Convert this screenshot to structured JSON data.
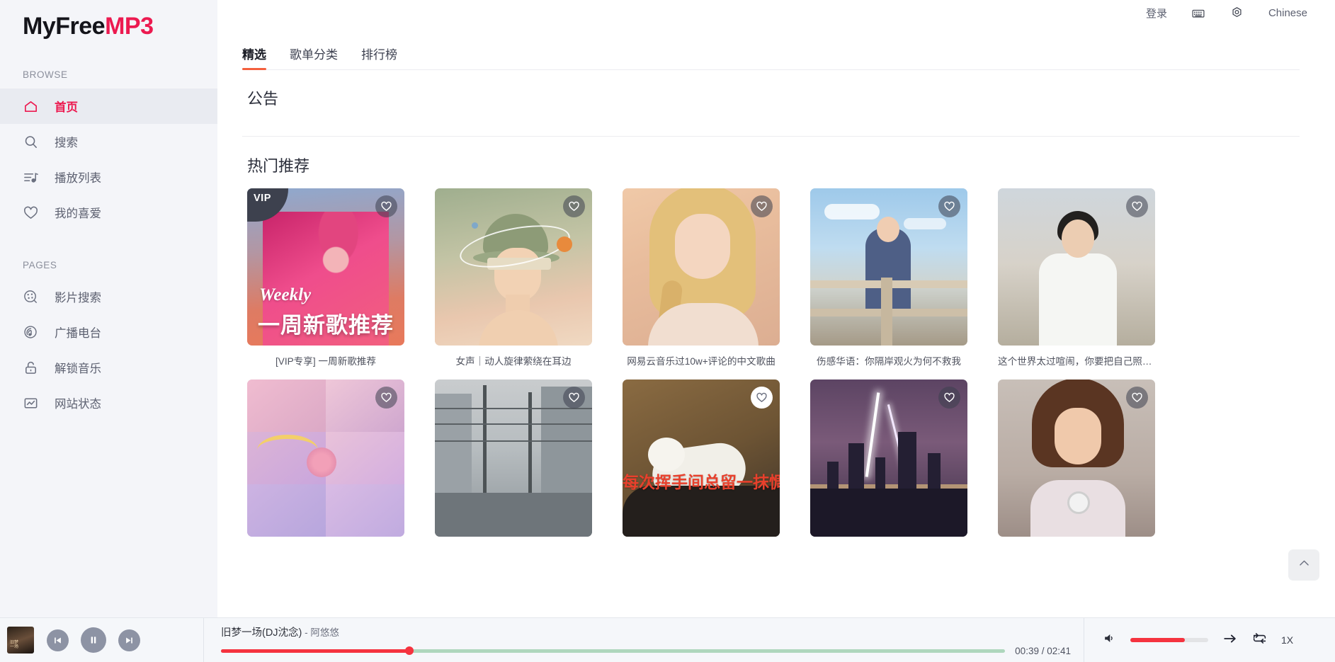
{
  "brand": {
    "part1": "MyFree",
    "part2": "MP3"
  },
  "sidebar": {
    "groups": [
      {
        "label": "BROWSE",
        "items": [
          {
            "label": "首页",
            "icon": "home-icon",
            "active": true
          },
          {
            "label": "搜索",
            "icon": "search-icon",
            "active": false
          },
          {
            "label": "播放列表",
            "icon": "playlist-icon",
            "active": false
          },
          {
            "label": "我的喜爱",
            "icon": "heart-icon",
            "active": false
          }
        ]
      },
      {
        "label": "PAGES",
        "items": [
          {
            "label": "影片搜索",
            "icon": "film-search-icon",
            "active": false
          },
          {
            "label": "广播电台",
            "icon": "radio-icon",
            "active": false
          },
          {
            "label": "解锁音乐",
            "icon": "unlock-icon",
            "active": false
          },
          {
            "label": "网站状态",
            "icon": "status-chart-icon",
            "active": false
          }
        ]
      }
    ]
  },
  "topbar": {
    "login": "登录",
    "keyboard_icon": "keyboard-icon",
    "settings_icon": "gear-icon",
    "language": "Chinese"
  },
  "tabs": [
    {
      "label": "精选",
      "active": true
    },
    {
      "label": "歌单分类",
      "active": false
    },
    {
      "label": "排行榜",
      "active": false
    }
  ],
  "sections": {
    "announcement_title": "公告",
    "recommend_title": "热门推荐"
  },
  "cards_row1": [
    {
      "caption": "[VIP专享] 一周新歌推荐",
      "badge": "VIP",
      "art": "art-weekly",
      "weekly_en": "Weekly",
      "weekly_zh": "一周新歌推荐"
    },
    {
      "caption": "女声｜动人旋律萦绕在耳边",
      "badge": "",
      "art": "art-fem"
    },
    {
      "caption": "网易云音乐过10w+评论的中文歌曲",
      "badge": "",
      "art": "art-lisa"
    },
    {
      "caption": "伤感华语：你隔岸观火为何不救我",
      "badge": "",
      "art": "art-rail"
    },
    {
      "caption": "这个世界太过喧闹，你要把自己照顾好",
      "badge": "",
      "art": "art-shirt"
    }
  ],
  "cards_row2": [
    {
      "caption": "",
      "badge": "",
      "art": "art-collage",
      "overlay": ""
    },
    {
      "caption": "",
      "badge": "",
      "art": "art-street",
      "overlay": ""
    },
    {
      "caption": "",
      "badge": "",
      "art": "art-cat",
      "overlay": "每次挥手间总留一抹惆怅"
    },
    {
      "caption": "",
      "badge": "",
      "art": "art-light",
      "overlay": ""
    },
    {
      "caption": "",
      "badge": "",
      "art": "art-girl",
      "overlay": ""
    }
  ],
  "scroll_top_icon": "chevron-up-icon",
  "player": {
    "prev_icon": "previous-track-icon",
    "play_pause_icon": "pause-icon",
    "next_icon": "next-track-icon",
    "track_title": "旧梦一场(DJ沈念)",
    "track_separator": " - ",
    "track_artist": "阿悠悠",
    "time": "00:39 / 02:41",
    "progress_percent": 24,
    "volume_icon": "volume-icon",
    "volume_percent": 70,
    "mode_icon": "arrow-right-icon",
    "repeat_icon": "repeat-icon",
    "speed": "1X"
  },
  "colors": {
    "accent_pink": "#ec1a50",
    "tab_underline": "#f4603e",
    "player_red": "#f5333f",
    "player_track_green": "#aed7bd",
    "sidebar_bg": "#f4f5f9",
    "overlay_red": "#e8402c"
  }
}
